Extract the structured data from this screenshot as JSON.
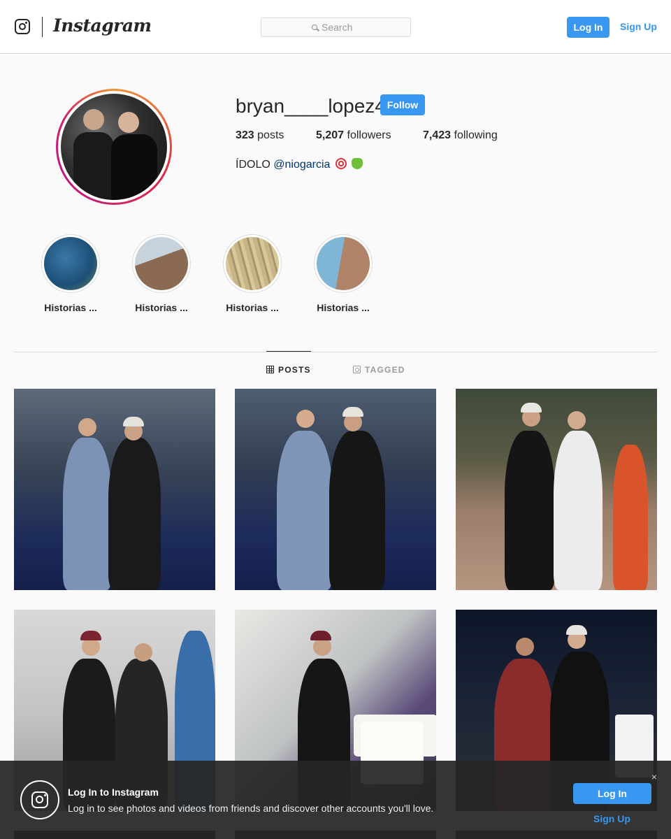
{
  "header": {
    "brand": "Instagram",
    "search_placeholder": "Search",
    "login_label": "Log In",
    "signup_label": "Sign Up"
  },
  "profile": {
    "username": "bryan____lopez4",
    "follow_label": "Follow",
    "stats": [
      {
        "count": "323",
        "label": "posts"
      },
      {
        "count": "5,207",
        "label": "followers"
      },
      {
        "count": "7,423",
        "label": "following"
      }
    ],
    "bio_text": "ÍDOLO",
    "bio_mention": "@niogarcia",
    "bio_emojis": [
      "target-emoji",
      "ogre-face-emoji"
    ]
  },
  "highlights": [
    {
      "label": "Historias ..."
    },
    {
      "label": "Historias ..."
    },
    {
      "label": "Historias ..."
    },
    {
      "label": "Historias ..."
    }
  ],
  "tabs": [
    {
      "label": "POSTS",
      "icon": "grid-icon",
      "active": true
    },
    {
      "label": "TAGGED",
      "icon": "tagged-icon",
      "active": false
    }
  ],
  "banner": {
    "title": "Log In to Instagram",
    "text": "Log in to see photos and videos from friends and discover other accounts you'll love.",
    "login_label": "Log In",
    "signup_label": "Sign Up",
    "close_glyph": "×"
  },
  "colors": {
    "accent": "#3897f0",
    "border": "#dbdbdb",
    "text": "#262626",
    "muted": "#999999"
  }
}
